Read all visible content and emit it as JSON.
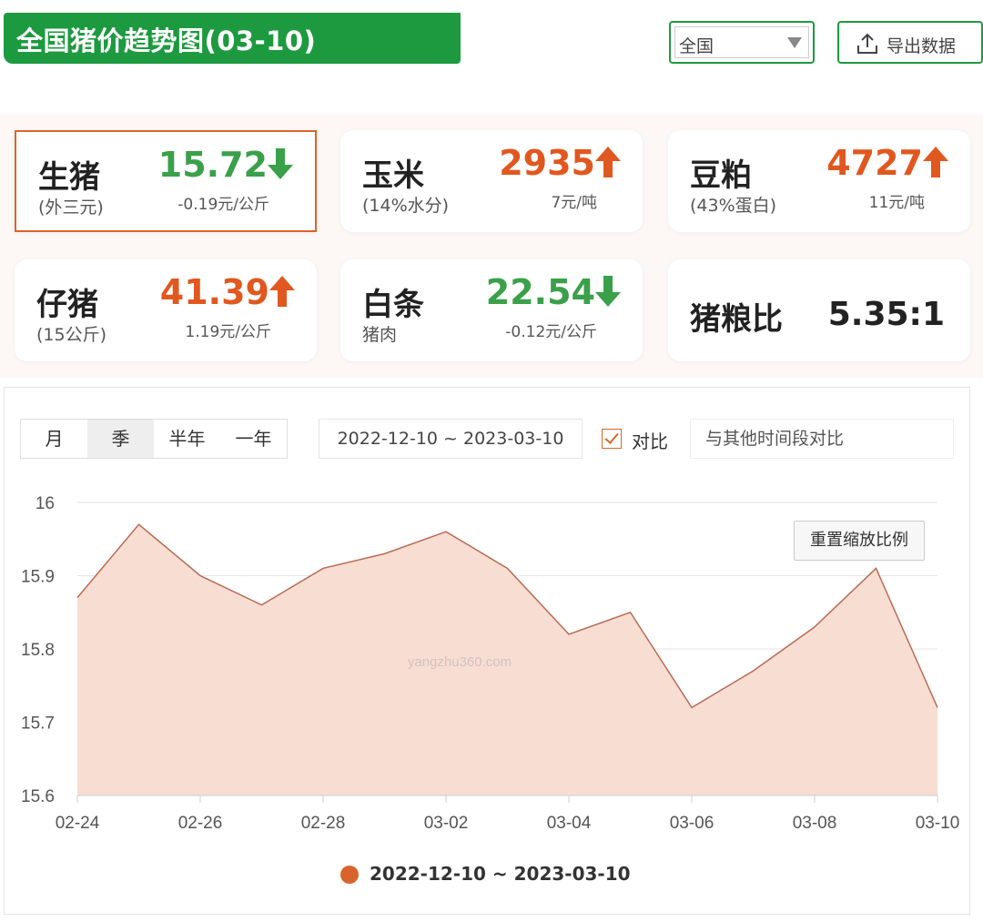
{
  "header": {
    "title": "全国猪价趋势图(03-10)",
    "region_select": "全国",
    "export_label": "导出数据"
  },
  "cards": [
    {
      "name": "生猪",
      "sub": "(外三元)",
      "price": "15.72",
      "trend": "down",
      "change": "-0.19元/公斤"
    },
    {
      "name": "玉米",
      "sub": "(14%水分)",
      "price": "2935",
      "trend": "up",
      "change": "7元/吨"
    },
    {
      "name": "豆粕",
      "sub": "(43%蛋白)",
      "price": "4727",
      "trend": "up",
      "change": "11元/吨"
    },
    {
      "name": "仔猪",
      "sub": "(15公斤)",
      "price": "41.39",
      "trend": "up",
      "change": "1.19元/公斤"
    },
    {
      "name": "白条",
      "sub": "猪肉",
      "price": "22.54",
      "trend": "down",
      "change": "-0.12元/公斤"
    },
    {
      "name": "猪粮比",
      "ratio": "5.35:1"
    }
  ],
  "controls": {
    "range_tabs": [
      "月",
      "季",
      "半年",
      "一年"
    ],
    "active_tab": "季",
    "date_range": "2022-12-10 ~ 2023-03-10",
    "compare_label": "对比",
    "compare_placeholder": "与其他时间段对比",
    "reset_zoom": "重置缩放比例"
  },
  "colors": {
    "brand_green": "#1d9a3f",
    "up": "#e0581f",
    "down": "#3aa04a",
    "series_line": "#b86b55",
    "series_fill": "#f8ddd2"
  },
  "chart_data": {
    "type": "area",
    "x": [
      "02-24",
      "02-25",
      "02-26",
      "02-27",
      "02-28",
      "03-01",
      "03-02",
      "03-03",
      "03-04",
      "03-05",
      "03-06",
      "03-07",
      "03-08",
      "03-09",
      "03-10"
    ],
    "xticks": [
      "02-24",
      "02-26",
      "02-28",
      "03-02",
      "03-04",
      "03-06",
      "03-08",
      "03-10"
    ],
    "series": [
      {
        "name": "2022-12-10 ~ 2023-03-10",
        "values": [
          15.87,
          15.97,
          15.9,
          15.86,
          15.91,
          15.93,
          15.96,
          15.91,
          15.82,
          15.85,
          15.72,
          15.77,
          15.83,
          15.91,
          15.72
        ]
      }
    ],
    "yticks": [
      15.6,
      15.7,
      15.8,
      15.9,
      16
    ],
    "ylim": [
      15.6,
      16
    ],
    "grid": true,
    "legend": "bottom",
    "watermark": "yangzhu360.com"
  }
}
